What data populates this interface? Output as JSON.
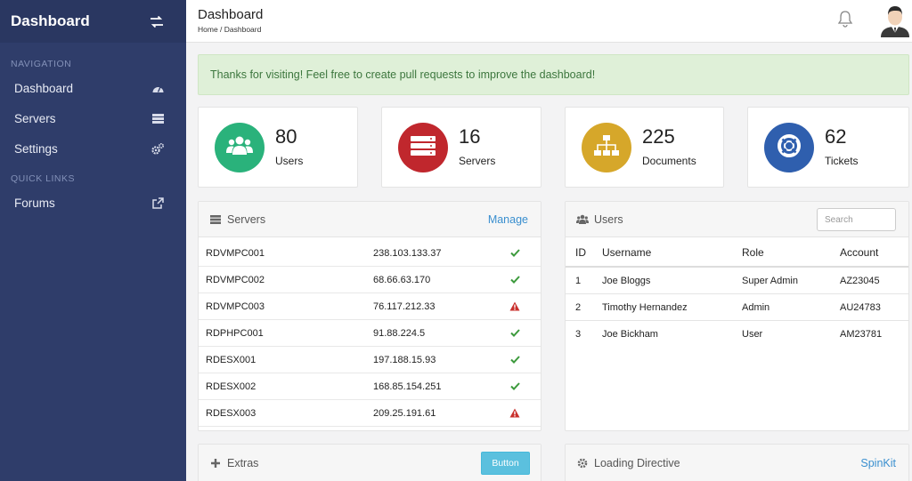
{
  "sidebar": {
    "title": "Dashboard",
    "sections": {
      "navigation": "NAVIGATION",
      "quick_links": "QUICK LINKS"
    },
    "items": [
      {
        "label": "Dashboard",
        "icon": "dashboard-icon"
      },
      {
        "label": "Servers",
        "icon": "server-icon"
      },
      {
        "label": "Settings",
        "icon": "cogs-icon"
      }
    ],
    "links": [
      {
        "label": "Forums",
        "icon": "external-link-icon"
      }
    ]
  },
  "header": {
    "title": "Dashboard",
    "breadcrumb": "Home / Dashboard"
  },
  "alert": {
    "text": "Thanks for visiting! Feel free to create pull requests to improve the dashboard!"
  },
  "stats": [
    {
      "value": "80",
      "label": "Users",
      "color": "#2ab27b",
      "icon": "users-icon"
    },
    {
      "value": "16",
      "label": "Servers",
      "color": "#c0272d",
      "icon": "server-icon"
    },
    {
      "value": "225",
      "label": "Documents",
      "color": "#d6a72a",
      "icon": "sitemap-icon"
    },
    {
      "value": "62",
      "label": "Tickets",
      "color": "#2f5fae",
      "icon": "life-ring-icon"
    }
  ],
  "servers_panel": {
    "title": "Servers",
    "link": "Manage",
    "rows": [
      {
        "name": "RDVMPC001",
        "ip": "238.103.133.37",
        "status": "ok"
      },
      {
        "name": "RDVMPC002",
        "ip": "68.66.63.170",
        "status": "ok"
      },
      {
        "name": "RDVMPC003",
        "ip": "76.117.212.33",
        "status": "warning"
      },
      {
        "name": "RDPHPC001",
        "ip": "91.88.224.5",
        "status": "ok"
      },
      {
        "name": "RDESX001",
        "ip": "197.188.15.93",
        "status": "ok"
      },
      {
        "name": "RDESX002",
        "ip": "168.85.154.251",
        "status": "ok"
      },
      {
        "name": "RDESX003",
        "ip": "209.25.191.61",
        "status": "warning"
      }
    ]
  },
  "users_panel": {
    "title": "Users",
    "search_placeholder": "Search",
    "columns": {
      "id": "ID",
      "username": "Username",
      "role": "Role",
      "account": "Account"
    },
    "rows": [
      {
        "id": "1",
        "username": "Joe Bloggs",
        "role": "Super Admin",
        "account": "AZ23045"
      },
      {
        "id": "2",
        "username": "Timothy Hernandez",
        "role": "Admin",
        "account": "AU24783"
      },
      {
        "id": "3",
        "username": "Joe Bickham",
        "role": "User",
        "account": "AM23781"
      }
    ]
  },
  "extras_panel": {
    "title": "Extras",
    "button": "Button"
  },
  "loading_panel": {
    "title": "Loading Directive",
    "link": "SpinKit"
  },
  "colors": {
    "ok": "#3c9a3c",
    "warning": "#c9302c",
    "link": "#3a8fcf"
  }
}
